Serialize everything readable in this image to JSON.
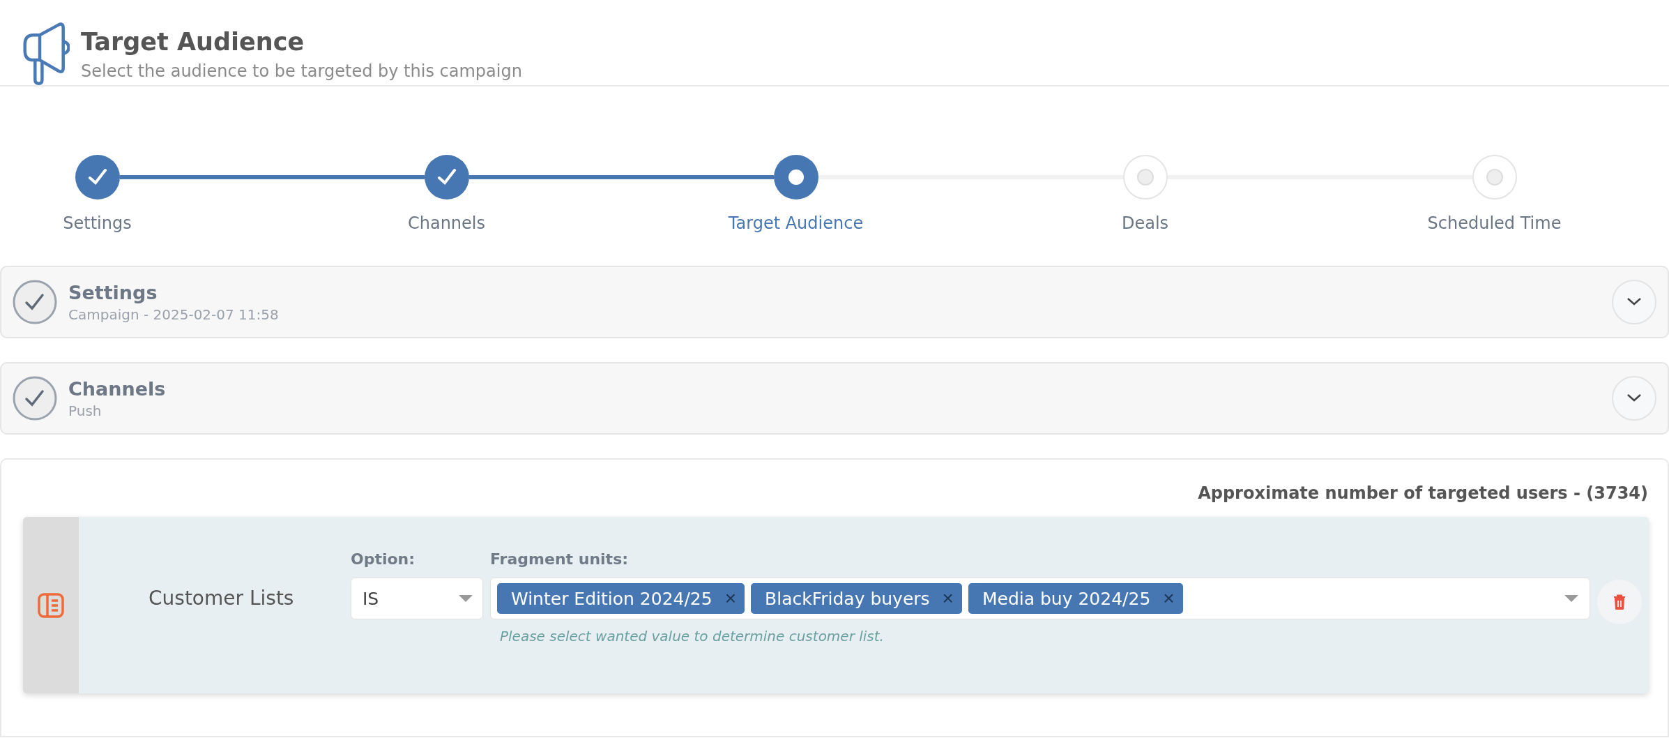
{
  "header": {
    "title": "Target Audience",
    "subtitle": "Select the audience to be targeted by this campaign"
  },
  "steps": [
    {
      "label": "Settings",
      "kind": "done"
    },
    {
      "label": "Channels",
      "kind": "done"
    },
    {
      "label": "Target Audience",
      "kind": "current"
    },
    {
      "label": "Deals",
      "kind": "upcoming"
    },
    {
      "label": "Scheduled Time",
      "kind": "upcoming"
    }
  ],
  "sections": [
    {
      "title": "Settings",
      "summary": "Campaign - 2025-02-07 11:58",
      "expanded": false
    },
    {
      "title": "Channels",
      "summary": "Push",
      "expanded": false
    }
  ],
  "audience": {
    "estimate": "Approximate number of targeted users - (3734)",
    "rule": {
      "name": "Customer Lists",
      "option_label": "Option:",
      "option_value": "IS",
      "fragment_label": "Fragment units:",
      "chips": [
        {
          "label": "Winter Edition 2024/25",
          "remove": "×"
        },
        {
          "label": "BlackFriday buyers",
          "remove": "×"
        },
        {
          "label": "Media buy 2024/25",
          "remove": "×"
        }
      ],
      "hint": "Please select wanted value to determine customer list."
    }
  }
}
